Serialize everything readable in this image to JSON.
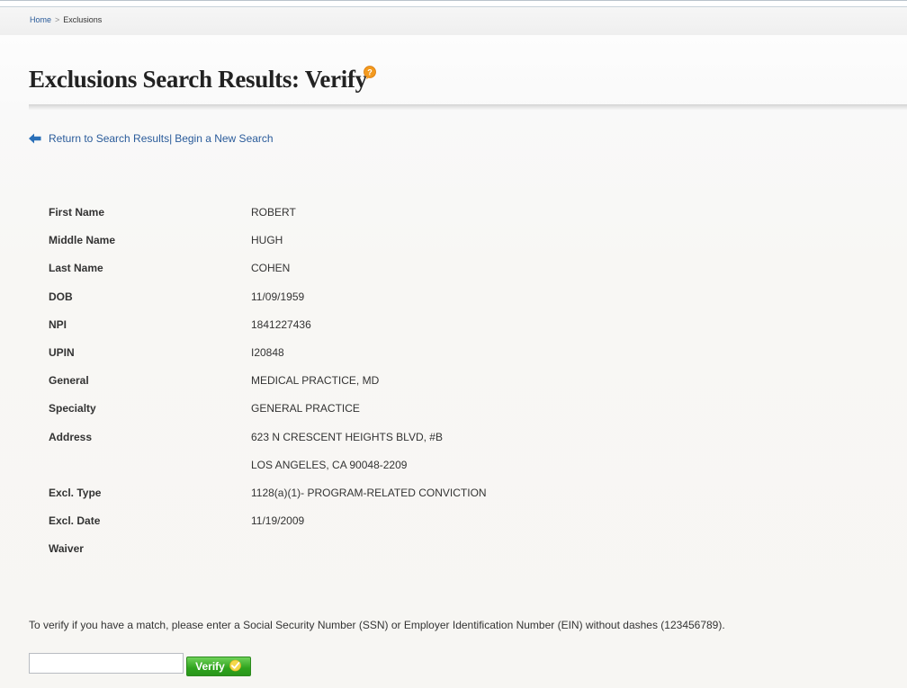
{
  "breadcrumb": {
    "home": "Home",
    "separator": ">",
    "current": "Exclusions"
  },
  "page": {
    "title": "Exclusions Search Results: Verify",
    "help_icon": "help-question-icon"
  },
  "nav": {
    "back_icon": "arrow-left-icon",
    "return_link": "Return to Search Results",
    "divider": "|",
    "new_search_link": "Begin a New Search"
  },
  "details": [
    {
      "label": "First Name",
      "value": "ROBERT"
    },
    {
      "label": "Middle Name",
      "value": "HUGH"
    },
    {
      "label": "Last Name",
      "value": "COHEN"
    },
    {
      "label": "DOB",
      "value": "11/09/1959"
    },
    {
      "label": "NPI",
      "value": "1841227436"
    },
    {
      "label": "UPIN",
      "value": "I20848"
    },
    {
      "label": "General",
      "value": "MEDICAL PRACTICE, MD"
    },
    {
      "label": "Specialty",
      "value": "GENERAL PRACTICE"
    },
    {
      "label": "Address",
      "value": "623 N CRESCENT HEIGHTS BLVD, #B"
    },
    {
      "label": "",
      "value": "LOS ANGELES, CA 90048-2209"
    },
    {
      "label": "Excl. Type",
      "value": "1128(a)(1)- PROGRAM-RELATED CONVICTION"
    },
    {
      "label": "Excl. Date",
      "value": "11/19/2009"
    },
    {
      "label": "Waiver",
      "value": ""
    }
  ],
  "verify": {
    "instructions": "To verify if you have a match, please enter a Social Security Number (SSN) or Employer Identification Number (EIN) without dashes (123456789).",
    "input_value": "",
    "button_label": "Verify",
    "button_icon": "check-icon"
  },
  "colors": {
    "link": "#2a5b9a",
    "button_green": "#2fa31e",
    "help_orange": "#f39a1f"
  }
}
